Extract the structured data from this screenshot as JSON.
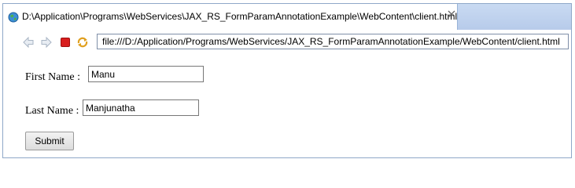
{
  "tab": {
    "title": "D:\\Application\\Programs\\WebServices\\JAX_RS_FormParamAnnotationExample\\WebContent\\client.html",
    "icon": "globe-icon",
    "close_icon": "close-icon"
  },
  "toolbar": {
    "back_icon": "back-arrow-icon",
    "forward_icon": "forward-arrow-icon",
    "stop_icon": "stop-icon",
    "refresh_icon": "refresh-icon",
    "url": "file:///D:/Application/Programs/WebServices/JAX_RS_FormParamAnnotationExample/WebContent/client.html"
  },
  "form": {
    "first_name_label": "First Name :",
    "first_name_value": "Manu",
    "last_name_label": "Last Name :",
    "last_name_value": "Manjunatha",
    "submit_label": "Submit"
  },
  "colors": {
    "tabbar": "#c9daf2",
    "border": "#8fa8c8",
    "stop": "#d81e1e"
  }
}
